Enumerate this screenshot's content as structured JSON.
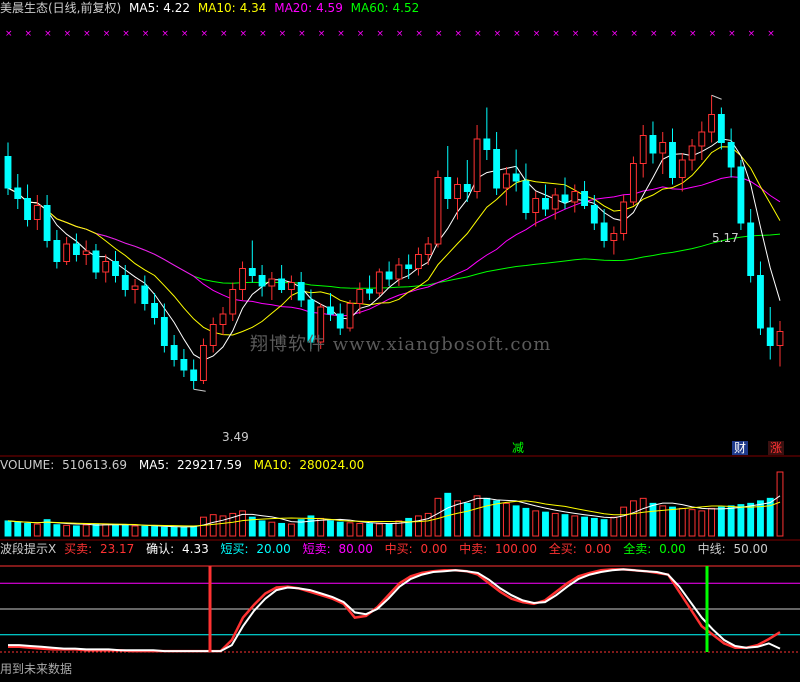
{
  "colors": {
    "up": "#ff3232",
    "down": "#00ffff",
    "ma5": "#ffffff",
    "ma10": "#ffff00",
    "ma20": "#ff00ff",
    "ma60": "#00ff00",
    "grid": "#800000"
  },
  "price_panel": {
    "title": "美晨生态(日线,前复权)",
    "ma5_label": "MA5:",
    "ma5_value": "4.22",
    "ma10_label": "MA10:",
    "ma10_value": "4.34",
    "ma20_label": "MA20:",
    "ma20_value": "4.59",
    "ma60_label": "MA60:",
    "ma60_value": "4.52",
    "high_label": "5.17",
    "low_label": "3.49",
    "watermark": "翔博软件 www.xiangbosoft.com",
    "tag_reduce": "减",
    "tag_finance": "财",
    "tag_rise": "涨"
  },
  "volume_panel": {
    "volume_label": "VOLUME:",
    "volume_value": "510613.69",
    "ma5_label": "MA5:",
    "ma5_value": "229217.59",
    "ma10_label": "MA10:",
    "ma10_value": "280024.00"
  },
  "indicator_panel": {
    "name": "波段提示X",
    "buy_label": "买卖:",
    "buy_value": "23.17",
    "confirm_label": "确认:",
    "confirm_value": "4.33",
    "short_buy_label": "短买:",
    "short_buy_value": "20.00",
    "short_sell_label": "短卖:",
    "short_sell_value": "80.00",
    "mid_buy_label": "中买:",
    "mid_buy_value": "0.00",
    "mid_sell_label": "中卖:",
    "mid_sell_value": "100.00",
    "all_sell_label": "全买:",
    "all_sell_value": "0.00",
    "all_buy_label": "全卖:",
    "all_buy_value": "0.00",
    "midline_label": "中线:",
    "midline_value": "50.00",
    "footer_note": "用到未来数据"
  },
  "chart_data": [
    {
      "type": "candlestick",
      "title": "美晨生态(日线,前复权)",
      "ylim": [
        3.2,
        5.6
      ],
      "annotations": [
        {
          "label": "5.17",
          "type": "high"
        },
        {
          "label": "3.49",
          "type": "low"
        }
      ],
      "candles": [
        [
          4.82,
          4.9,
          4.6,
          4.64
        ],
        [
          4.64,
          4.72,
          4.52,
          4.58
        ],
        [
          4.58,
          4.66,
          4.42,
          4.46
        ],
        [
          4.46,
          4.6,
          4.4,
          4.54
        ],
        [
          4.54,
          4.6,
          4.3,
          4.34
        ],
        [
          4.34,
          4.4,
          4.18,
          4.22
        ],
        [
          4.22,
          4.36,
          4.2,
          4.32
        ],
        [
          4.32,
          4.38,
          4.22,
          4.26
        ],
        [
          4.26,
          4.34,
          4.2,
          4.28
        ],
        [
          4.28,
          4.32,
          4.12,
          4.16
        ],
        [
          4.16,
          4.26,
          4.1,
          4.22
        ],
        [
          4.22,
          4.28,
          4.1,
          4.14
        ],
        [
          4.14,
          4.2,
          4.02,
          4.06
        ],
        [
          4.06,
          4.12,
          3.98,
          4.08
        ],
        [
          4.08,
          4.14,
          3.94,
          3.98
        ],
        [
          3.98,
          4.04,
          3.86,
          3.9
        ],
        [
          3.9,
          3.98,
          3.7,
          3.74
        ],
        [
          3.74,
          3.8,
          3.62,
          3.66
        ],
        [
          3.66,
          3.72,
          3.56,
          3.6
        ],
        [
          3.6,
          3.66,
          3.49,
          3.54
        ],
        [
          3.54,
          3.78,
          3.52,
          3.74
        ],
        [
          3.74,
          3.9,
          3.7,
          3.86
        ],
        [
          3.86,
          3.96,
          3.8,
          3.92
        ],
        [
          3.92,
          4.1,
          3.88,
          4.06
        ],
        [
          4.06,
          4.22,
          4.0,
          4.18
        ],
        [
          4.18,
          4.34,
          4.1,
          4.14
        ],
        [
          4.14,
          4.2,
          4.02,
          4.08
        ],
        [
          4.08,
          4.16,
          4.0,
          4.12
        ],
        [
          4.12,
          4.2,
          4.04,
          4.06
        ],
        [
          4.06,
          4.14,
          4.0,
          4.1
        ],
        [
          4.1,
          4.16,
          3.96,
          4.0
        ],
        [
          4.0,
          4.06,
          3.72,
          3.76
        ],
        [
          3.76,
          3.98,
          3.72,
          3.96
        ],
        [
          3.96,
          4.04,
          3.88,
          3.92
        ],
        [
          3.92,
          3.98,
          3.8,
          3.84
        ],
        [
          3.84,
          4.0,
          3.82,
          3.98
        ],
        [
          3.98,
          4.1,
          3.92,
          4.06
        ],
        [
          4.06,
          4.14,
          4.0,
          4.04
        ],
        [
          4.04,
          4.18,
          4.02,
          4.16
        ],
        [
          4.16,
          4.22,
          4.08,
          4.12
        ],
        [
          4.12,
          4.24,
          4.08,
          4.2
        ],
        [
          4.2,
          4.26,
          4.12,
          4.18
        ],
        [
          4.18,
          4.3,
          4.14,
          4.26
        ],
        [
          4.26,
          4.36,
          4.2,
          4.32
        ],
        [
          4.32,
          4.74,
          4.3,
          4.7
        ],
        [
          4.7,
          4.88,
          4.52,
          4.58
        ],
        [
          4.58,
          4.7,
          4.46,
          4.66
        ],
        [
          4.66,
          4.8,
          4.56,
          4.62
        ],
        [
          4.62,
          5.0,
          4.58,
          4.92
        ],
        [
          4.92,
          5.1,
          4.8,
          4.86
        ],
        [
          4.86,
          4.96,
          4.6,
          4.64
        ],
        [
          4.64,
          4.76,
          4.54,
          4.72
        ],
        [
          4.72,
          4.86,
          4.62,
          4.68
        ],
        [
          4.68,
          4.78,
          4.46,
          4.5
        ],
        [
          4.5,
          4.62,
          4.42,
          4.58
        ],
        [
          4.58,
          4.66,
          4.48,
          4.52
        ],
        [
          4.52,
          4.64,
          4.46,
          4.6
        ],
        [
          4.6,
          4.7,
          4.52,
          4.56
        ],
        [
          4.56,
          4.66,
          4.5,
          4.62
        ],
        [
          4.62,
          4.68,
          4.52,
          4.54
        ],
        [
          4.54,
          4.6,
          4.4,
          4.44
        ],
        [
          4.44,
          4.52,
          4.3,
          4.34
        ],
        [
          4.34,
          4.42,
          4.26,
          4.38
        ],
        [
          4.38,
          4.6,
          4.34,
          4.56
        ],
        [
          4.56,
          4.82,
          4.54,
          4.78
        ],
        [
          4.78,
          5.0,
          4.7,
          4.94
        ],
        [
          4.94,
          5.02,
          4.78,
          4.84
        ],
        [
          4.84,
          4.96,
          4.72,
          4.9
        ],
        [
          4.9,
          4.98,
          4.66,
          4.7
        ],
        [
          4.7,
          4.84,
          4.62,
          4.8
        ],
        [
          4.8,
          4.92,
          4.74,
          4.88
        ],
        [
          4.88,
          5.02,
          4.8,
          4.96
        ],
        [
          4.96,
          5.17,
          4.9,
          5.06
        ],
        [
          5.06,
          5.1,
          4.86,
          4.9
        ],
        [
          4.9,
          4.98,
          4.7,
          4.76
        ],
        [
          4.76,
          4.8,
          4.4,
          4.44
        ],
        [
          4.44,
          4.52,
          4.1,
          4.14
        ],
        [
          4.14,
          4.22,
          3.8,
          3.84
        ],
        [
          3.84,
          3.96,
          3.66,
          3.74
        ],
        [
          3.74,
          3.88,
          3.62,
          3.82
        ]
      ],
      "ma": {
        "MA5": {
          "label": "MA5",
          "value": 4.22
        },
        "MA10": {
          "label": "MA10",
          "value": 4.34
        },
        "MA20": {
          "label": "MA20",
          "value": 4.59
        },
        "MA60": {
          "label": "MA60",
          "value": 4.52
        }
      }
    },
    {
      "type": "bar",
      "title": "VOLUME",
      "values": [
        120,
        110,
        100,
        95,
        130,
        90,
        85,
        80,
        88,
        92,
        96,
        90,
        85,
        80,
        78,
        75,
        70,
        72,
        68,
        80,
        150,
        170,
        160,
        180,
        200,
        150,
        120,
        110,
        100,
        95,
        130,
        160,
        140,
        120,
        110,
        105,
        100,
        98,
        96,
        95,
        120,
        140,
        160,
        180,
        300,
        340,
        280,
        260,
        320,
        300,
        280,
        260,
        240,
        220,
        200,
        190,
        180,
        170,
        160,
        150,
        140,
        130,
        150,
        230,
        280,
        300,
        260,
        240,
        230,
        220,
        210,
        200,
        220,
        230,
        240,
        250,
        260,
        280,
        300,
        510
      ],
      "ma5_value": 229217.59,
      "ma10_value": 280024.0
    },
    {
      "type": "line",
      "title": "波段提示X",
      "ylim": [
        0,
        100
      ],
      "series": [
        {
          "name": "买卖",
          "values": [
            6,
            6,
            5,
            4,
            3,
            3,
            3,
            2,
            2,
            2,
            2,
            1,
            1,
            1,
            1,
            1,
            1,
            1,
            1,
            1,
            14,
            40,
            55,
            68,
            75,
            76,
            74,
            70,
            66,
            62,
            56,
            40,
            42,
            52,
            66,
            80,
            88,
            92,
            94,
            95,
            95,
            94,
            90,
            80,
            70,
            62,
            58,
            56,
            60,
            70,
            80,
            88,
            92,
            95,
            96,
            96,
            95,
            94,
            92,
            90,
            70,
            50,
            30,
            20,
            10,
            5,
            5,
            8,
            15,
            23
          ]
        },
        {
          "name": "确认",
          "values": [
            8,
            8,
            7,
            6,
            5,
            4,
            4,
            3,
            3,
            3,
            2,
            2,
            2,
            2,
            1,
            1,
            1,
            1,
            1,
            1,
            8,
            30,
            48,
            62,
            72,
            75,
            74,
            72,
            68,
            64,
            58,
            46,
            44,
            50,
            62,
            76,
            85,
            90,
            93,
            94,
            95,
            94,
            92,
            84,
            74,
            66,
            60,
            57,
            58,
            66,
            76,
            85,
            90,
            93,
            95,
            96,
            95,
            94,
            93,
            90,
            76,
            58,
            40,
            26,
            14,
            7,
            5,
            6,
            10,
            4
          ]
        }
      ],
      "levels": {
        "short_buy": 20,
        "short_sell": 80,
        "mid_buy": 0,
        "mid_sell": 100,
        "midline": 50
      }
    }
  ]
}
